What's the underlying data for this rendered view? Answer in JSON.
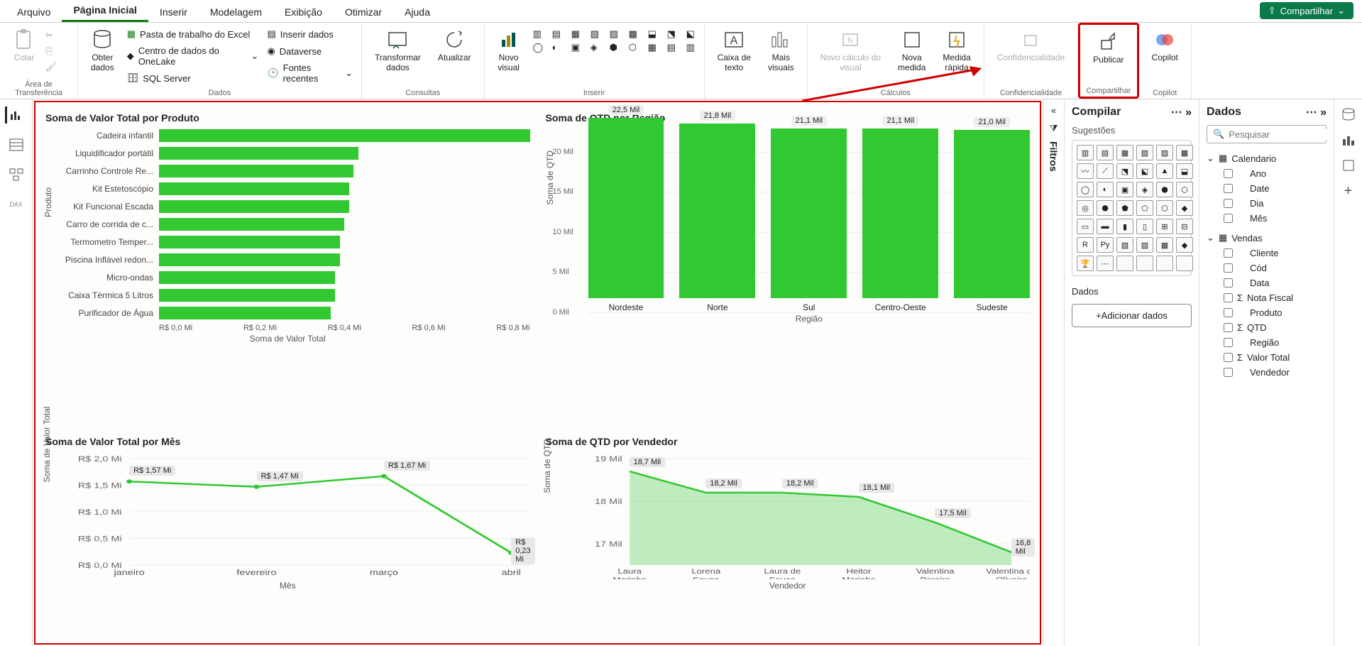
{
  "tabs": [
    "Arquivo",
    "Página Inicial",
    "Inserir",
    "Modelagem",
    "Exibição",
    "Otimizar",
    "Ajuda"
  ],
  "active_tab": 1,
  "share_label": "Compartilhar",
  "ribbon": {
    "area_transferencia": "Área de Transferência",
    "colar": "Colar",
    "dados_group": "Dados",
    "obter_dados": "Obter\ndados",
    "excel": "Pasta de trabalho do Excel",
    "onelake": "Centro de dados do OneLake",
    "sql": "SQL Server",
    "inserir_dados": "Inserir dados",
    "dataverse": "Dataverse",
    "fontes_recentes": "Fontes recentes",
    "consultas_group": "Consultas",
    "transformar": "Transformar\ndados",
    "atualizar": "Atualizar",
    "inserir_group": "Inserir",
    "novo_visual": "Novo\nvisual",
    "caixa_texto": "Caixa de\ntexto",
    "mais_visuais": "Mais\nvisuais",
    "calculos_group": "Cálculos",
    "novo_calculo": "Novo cálculo do\nvisual",
    "nova_medida": "Nova\nmedida",
    "medida_rapida": "Medida\nrápida",
    "confid_group": "Confidencialidade",
    "confidencialidade": "Confidencialidade",
    "compartilhar_group": "Compartilhar",
    "publicar": "Publicar",
    "copilot_group": "Copilot",
    "copilot": "Copilot"
  },
  "filters_label": "Filtros",
  "compilar": {
    "title": "Compilar",
    "sugestoes": "Sugestões",
    "dados_label": "Dados",
    "add_data": "+Adicionar dados"
  },
  "dados_pane": {
    "title": "Dados",
    "search_placeholder": "Pesquisar",
    "tables": {
      "Calendario": [
        "Ano",
        "Date",
        "Dia",
        "Mês"
      ],
      "Vendas": [
        "Cliente",
        "Cód",
        "Data",
        "Nota Fiscal",
        "Produto",
        "QTD",
        "Região",
        "Valor Total",
        "Vendedor"
      ]
    },
    "sigma_fields": [
      "Nota Fiscal",
      "QTD",
      "Valor Total"
    ]
  },
  "chart_data": [
    {
      "type": "bar",
      "orientation": "horizontal",
      "title": "Soma de Valor Total por Produto",
      "ylabel": "Produto",
      "xlabel": "Soma de Valor Total",
      "categories": [
        "Cadeira infantil",
        "Liquidificador portátil",
        "Carrinho Controle Re...",
        "Kit Estetoscópio",
        "Kit Funcional Escada",
        "Carro de corrida de c...",
        "Termometro Temper...",
        "Piscina Inflável redon...",
        "Micro-ondas",
        "Caixa Térmica 5 Litros",
        "Purificador de Água"
      ],
      "values": [
        0.8,
        0.43,
        0.42,
        0.41,
        0.41,
        0.4,
        0.39,
        0.39,
        0.38,
        0.38,
        0.37
      ],
      "x_ticks": [
        "R$ 0,0 Mi",
        "R$ 0,2 Mi",
        "R$ 0,4 Mi",
        "R$ 0,6 Mi",
        "R$ 0,8 Mi"
      ],
      "xlim": [
        0,
        0.8
      ]
    },
    {
      "type": "bar",
      "orientation": "vertical",
      "title": "Soma de QTD por Região",
      "ylabel": "Soma de QTD",
      "xlabel": "Região",
      "categories": [
        "Nordeste",
        "Norte",
        "Sul",
        "Centro-Oeste",
        "Sudeste"
      ],
      "values": [
        22.5,
        21.8,
        21.1,
        21.1,
        21.0
      ],
      "value_labels": [
        "22,5 Mil",
        "21,8 Mil",
        "21,1 Mil",
        "21,1 Mil",
        "21,0 Mil"
      ],
      "y_ticks": [
        "0 Mil",
        "5 Mil",
        "10 Mil",
        "15 Mil",
        "20 Mil"
      ],
      "ylim": [
        0,
        23
      ]
    },
    {
      "type": "line",
      "title": "Soma de Valor Total por Mês",
      "ylabel": "Soma de Valor Total",
      "xlabel": "Mês",
      "categories": [
        "janeiro",
        "fevereiro",
        "março",
        "abril"
      ],
      "values": [
        1.57,
        1.47,
        1.67,
        0.23
      ],
      "value_labels": [
        "R$ 1,57 Mi",
        "R$ 1,47 Mi",
        "R$ 1,67 Mi",
        "R$ 0,23 Mi"
      ],
      "y_ticks": [
        "R$ 0,0 Mi",
        "R$ 0,5 Mi",
        "R$ 1,0 Mi",
        "R$ 1,5 Mi",
        "R$ 2,0 Mi"
      ],
      "ylim": [
        0,
        2.0
      ]
    },
    {
      "type": "area",
      "title": "Soma de QTD por Vendedor",
      "ylabel": "Soma de QTD",
      "xlabel": "Vendedor",
      "categories": [
        "Laura Marinho",
        "Lorena Sousa",
        "Laura de Sousa",
        "Heitor Marinho",
        "Valentina Pereira",
        "Valentina de Oliveira"
      ],
      "values": [
        18.7,
        18.2,
        18.2,
        18.1,
        17.5,
        16.8
      ],
      "value_labels": [
        "18,7 Mil",
        "18,2 Mil",
        "18,2 Mil",
        "18,1 Mil",
        "17,5 Mil",
        "16,8 Mil"
      ],
      "y_ticks": [
        "17 Mil",
        "18 Mil",
        "19 Mil"
      ],
      "ylim": [
        16.5,
        19
      ]
    }
  ]
}
